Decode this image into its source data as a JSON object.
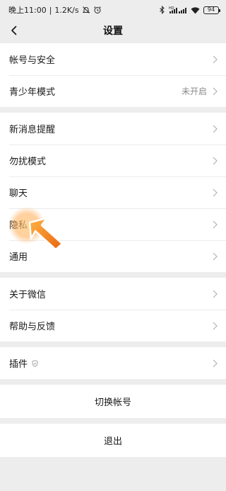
{
  "status_bar": {
    "time": "晚上11:00",
    "separator": "|",
    "network_speed": "1.2K/s",
    "signal_tag": "HD",
    "battery": "94",
    "icons": [
      "mute-bell-icon",
      "alarm-icon",
      "bluetooth-icon",
      "signal-icon",
      "wifi-icon",
      "battery-icon"
    ]
  },
  "nav": {
    "title": "设置",
    "back_icon": "chevron-left-icon"
  },
  "groups": [
    {
      "items": [
        {
          "label": "帐号与安全"
        },
        {
          "label": "青少年模式",
          "value": "未开启"
        }
      ]
    },
    {
      "items": [
        {
          "label": "新消息提醒"
        },
        {
          "label": "勿扰模式"
        },
        {
          "label": "聊天"
        },
        {
          "label": "隐私"
        },
        {
          "label": "通用"
        }
      ]
    },
    {
      "items": [
        {
          "label": "关于微信"
        },
        {
          "label": "帮助与反馈"
        }
      ]
    },
    {
      "items": [
        {
          "label": "插件",
          "icon": "shield-icon"
        }
      ]
    }
  ],
  "actions": {
    "switch_account": "切换帐号",
    "logout": "退出"
  },
  "colors": {
    "background": "#ededed",
    "card": "#ffffff",
    "pointer": "#f07818"
  }
}
